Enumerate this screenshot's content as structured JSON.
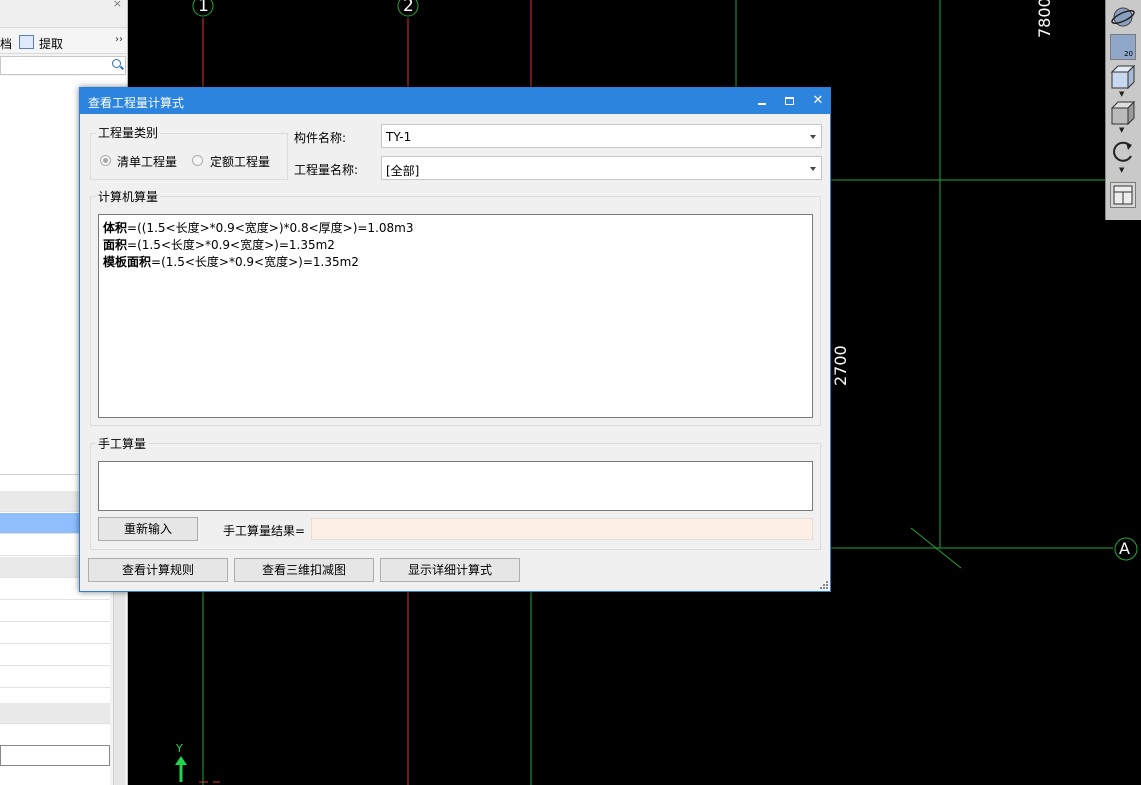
{
  "left_panel": {
    "toolbar_partial_label": "档",
    "toolbar_extract_label": "提取",
    "toolbar_more": "››"
  },
  "cad": {
    "axis_top_labels": [
      "1",
      "2"
    ],
    "axis_right_label": "A",
    "dim_7800": "7800",
    "dim_2700": "2700",
    "ucs_y_label": "Y",
    "line_color_red": "#e23131",
    "line_color_green": "#1fa83a"
  },
  "view_toolbar": {
    "zoom_badge": "20"
  },
  "dialog": {
    "title": "查看工程量计算式",
    "quantity_type_group": {
      "legend": "工程量类别",
      "option_bill": "清单工程量",
      "option_quota": "定额工程量",
      "selected": "清单工程量"
    },
    "component_name_label": "构件名称:",
    "component_name_value": "TY-1",
    "quantity_name_label": "工程量名称:",
    "quantity_name_value": "[全部]",
    "computer_calc_group": {
      "legend": "计算机算量",
      "formulas": [
        {
          "name": "体积",
          "expr": "=((1.5<长度>*0.9<宽度>)*0.8<厚度>)=1.08m3"
        },
        {
          "name": "面积",
          "expr": "=(1.5<长度>*0.9<宽度>)=1.35m2"
        },
        {
          "name": "模板面积",
          "expr": "=(1.5<长度>*0.9<宽度>)=1.35m2"
        }
      ]
    },
    "manual_calc_group": {
      "legend": "手工算量",
      "reinput_button": "重新输入",
      "result_label": "手工算量结果=",
      "result_value": ""
    },
    "buttons": {
      "view_rules": "查看计算规则",
      "view_3d": "查看三维扣减图",
      "show_detail": "显示详细计算式"
    },
    "colors": {
      "titlebar": "#2d84de",
      "result_bg": "#fbefe6"
    }
  }
}
